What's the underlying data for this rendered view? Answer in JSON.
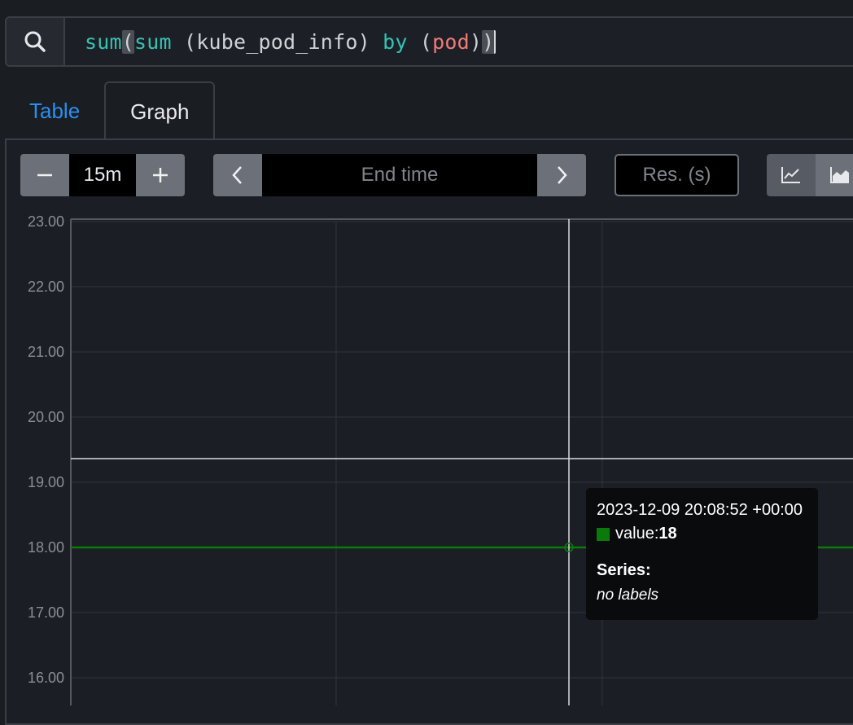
{
  "query": {
    "parts": [
      {
        "text": "sum",
        "cls": "q-fn"
      },
      {
        "text": "(",
        "cls": "q-match"
      },
      {
        "text": "sum",
        "cls": "q-fn"
      },
      {
        "text": " (kube_pod_info) ",
        "cls": ""
      },
      {
        "text": "by",
        "cls": "q-kw"
      },
      {
        "text": " (",
        "cls": ""
      },
      {
        "text": "pod",
        "cls": "q-label"
      },
      {
        "text": ")",
        "cls": ""
      },
      {
        "text": ")",
        "cls": "q-match q-cursor"
      }
    ]
  },
  "tabs": {
    "table": "Table",
    "graph": "Graph"
  },
  "controls": {
    "range_minus": "−",
    "range_value": "15m",
    "range_plus": "+",
    "prev": "‹",
    "end_time_placeholder": "End time",
    "next": "›",
    "resolution_placeholder": "Res. (s)"
  },
  "icons": {
    "search": "search-icon",
    "line_chart": "line-chart-icon",
    "stacked_chart": "stacked-chart-icon"
  },
  "chart_data": {
    "type": "line",
    "ylim": [
      15.7,
      23.0
    ],
    "y_ticks": [
      "23.00",
      "22.00",
      "21.00",
      "20.00",
      "19.00",
      "18.00",
      "17.00",
      "16.00"
    ],
    "series": [
      {
        "values": [
          18,
          18,
          18
        ],
        "color": "#0b7a0b"
      }
    ],
    "hover_value": 18
  },
  "tooltip": {
    "timestamp": "2023-12-09 20:08:52 +00:00",
    "value_label": "value: ",
    "value": "18",
    "series_label": "Series:",
    "labels_text": "no labels"
  },
  "colors": {
    "background": "#1a1d22",
    "accent": "#2a8ff0",
    "series": "#0b7a0b"
  }
}
